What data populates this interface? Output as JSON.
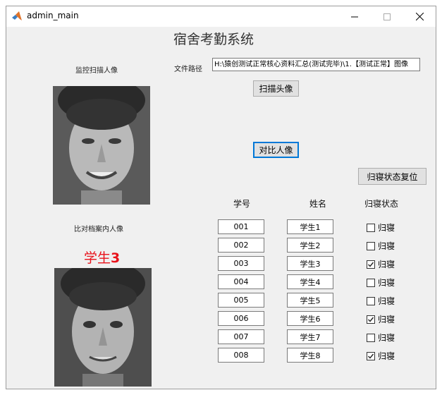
{
  "window": {
    "title": "admin_main"
  },
  "app": {
    "title": "宿舍考勤系统",
    "scan_label": "监控扫描人像",
    "compare_label": "比对档案内人像",
    "path_label": "文件路径",
    "path_value": "H:\\猿创测试正常核心资料汇总(测试完毕)\\1.【测试正常】图像",
    "scan_button": "扫描头像",
    "compare_button": "对比人像",
    "reset_button": "归寝状态复位",
    "matched_name_prefix": "学生",
    "matched_name_number": "3",
    "headers": {
      "id": "学号",
      "name": "姓名",
      "status": "归寝状态"
    },
    "status_label": "归寝",
    "students": [
      {
        "id": "001",
        "name": "学生1",
        "checked": false
      },
      {
        "id": "002",
        "name": "学生2",
        "checked": false
      },
      {
        "id": "003",
        "name": "学生3",
        "checked": true
      },
      {
        "id": "004",
        "name": "学生4",
        "checked": false
      },
      {
        "id": "005",
        "name": "学生5",
        "checked": false
      },
      {
        "id": "006",
        "name": "学生6",
        "checked": true
      },
      {
        "id": "007",
        "name": "学生7",
        "checked": false
      },
      {
        "id": "008",
        "name": "学生8",
        "checked": true
      }
    ]
  },
  "colors": {
    "accent": "#0078d7",
    "highlight_name": "#e8121a",
    "window_bg": "#f0f0f0"
  },
  "icons": {
    "app": "matlab-icon",
    "minimize": "minimize-icon",
    "maximize": "maximize-icon",
    "close": "close-icon"
  }
}
